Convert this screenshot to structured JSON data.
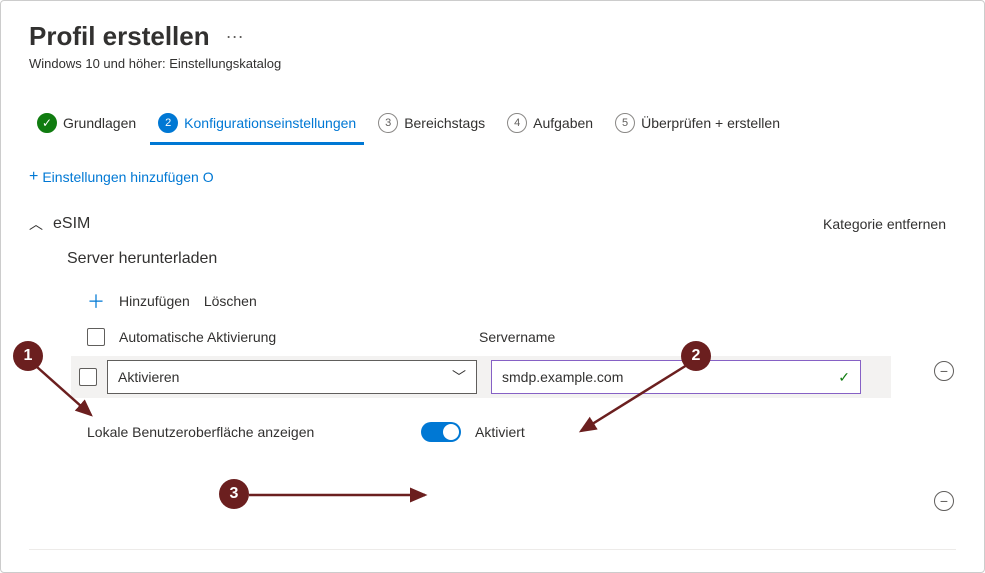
{
  "header": {
    "title": "Profil erstellen",
    "subtitle": "Windows 10 und höher: Einstellungskatalog"
  },
  "wizard": {
    "steps": [
      {
        "label": "Grundlagen"
      },
      {
        "label": "Konfigurationseinstellungen",
        "num": "2"
      },
      {
        "label": "Bereichstags",
        "num": "3"
      },
      {
        "label": "Aufgaben",
        "num": "4"
      },
      {
        "label": "Überprüfen + erstellen",
        "num": "5"
      }
    ]
  },
  "addSettings": "Einstellungen hinzufügen O",
  "category": {
    "name": "eSIM",
    "remove": "Kategorie entfernen"
  },
  "section": {
    "title": "Server herunterladen",
    "add": "Hinzufügen",
    "delete": "Löschen",
    "colAuto": "Automatische Aktivierung",
    "colServer": "Servername",
    "dropdownValue": "Aktivieren",
    "serverValue": "smdp.example.com",
    "toggleLabel": "Lokale Benutzeroberfläche anzeigen",
    "toggleState": "Aktiviert"
  },
  "callouts": {
    "1": "1",
    "2": "2",
    "3": "3"
  }
}
